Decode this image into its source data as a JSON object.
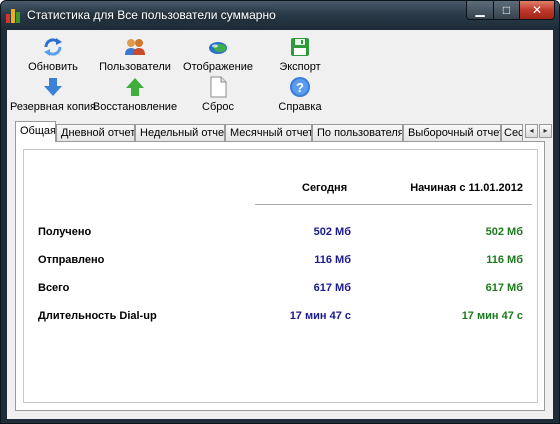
{
  "window": {
    "title": "Статистика для Все пользователи суммарно",
    "controls": {
      "minimize": "▁",
      "maximize": "□",
      "close": "✕"
    }
  },
  "toolbar": {
    "refresh": {
      "label": "Обновить",
      "icon": "refresh-icon"
    },
    "users": {
      "label": "Пользователи",
      "icon": "users-icon"
    },
    "display": {
      "label": "Отображение",
      "icon": "display-icon"
    },
    "export": {
      "label": "Экспорт",
      "icon": "save-icon"
    },
    "backup": {
      "label": "Резервная копия",
      "icon": "arrow-down-icon"
    },
    "restore": {
      "label": "Восстановление",
      "icon": "arrow-up-icon"
    },
    "reset": {
      "label": "Сброс",
      "icon": "document-icon"
    },
    "help": {
      "label": "Справка",
      "icon": "help-icon"
    }
  },
  "tabs": [
    {
      "label": "Общая",
      "active": true
    },
    {
      "label": "Дневной отчет",
      "active": false
    },
    {
      "label": "Недельный отчет",
      "active": false
    },
    {
      "label": "Месячный отчет",
      "active": false
    },
    {
      "label": "По пользователям",
      "active": false
    },
    {
      "label": "Выборочный отчет",
      "active": false
    },
    {
      "label": "Сес",
      "active": false
    }
  ],
  "tab_scroll": {
    "left": "◂",
    "right": "▸"
  },
  "summary": {
    "col_today": "Сегодня",
    "col_since": "Начиная с 11.01.2012",
    "rows": [
      {
        "label": "Получено",
        "today": "502 Мб",
        "since": "502 Мб"
      },
      {
        "label": "Отправлено",
        "today": "116 Мб",
        "since": "116 Мб"
      },
      {
        "label": "Всего",
        "today": "617 Мб",
        "since": "617 Мб"
      },
      {
        "label": "Длительность Dial-up",
        "today": "17 мин 47 с",
        "since": "17 мин 47 с"
      }
    ]
  },
  "colors": {
    "today_value": "#1a1a8c",
    "since_value": "#1c7a1c",
    "titlebar": "#2a3a48",
    "close_button": "#c0392b"
  }
}
